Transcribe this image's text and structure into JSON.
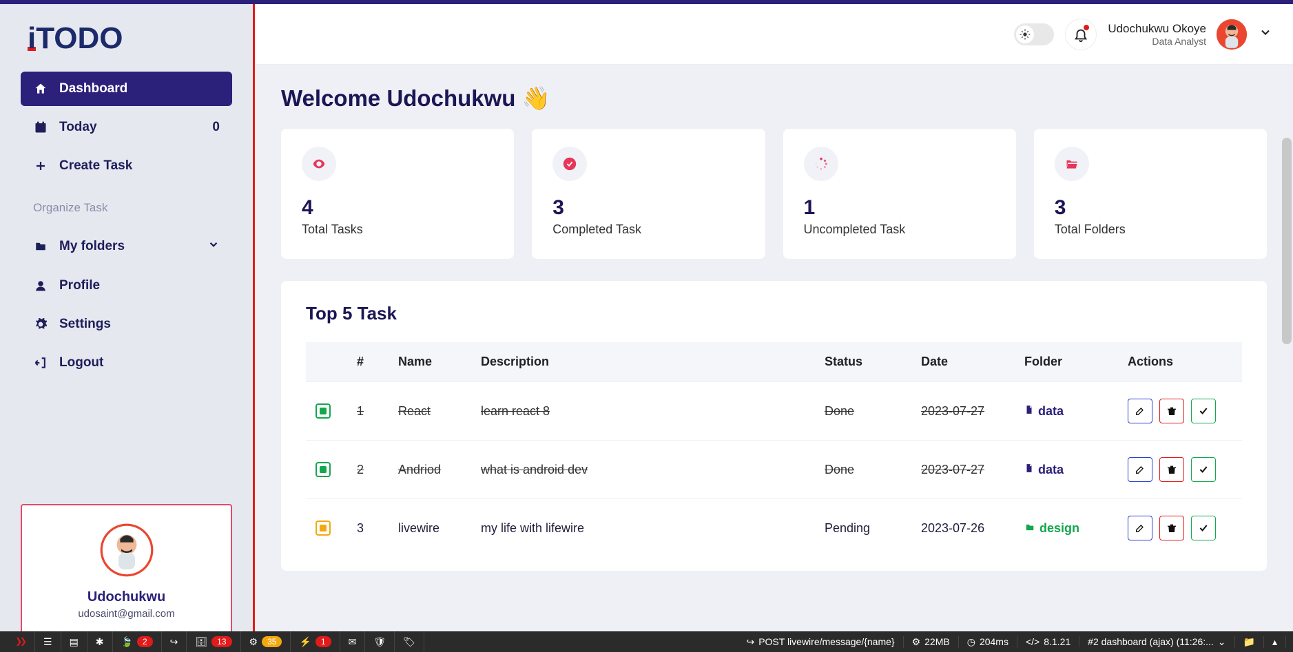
{
  "brand": "iTODO",
  "sidebar": {
    "items": [
      {
        "label": "Dashboard"
      },
      {
        "label": "Today",
        "count": "0"
      },
      {
        "label": "Create Task"
      }
    ],
    "section": "Organize Task",
    "items2": [
      {
        "label": "My folders"
      },
      {
        "label": "Profile"
      },
      {
        "label": "Settings"
      },
      {
        "label": "Logout"
      }
    ]
  },
  "user_card": {
    "name": "Udochukwu",
    "email": "udosaint@gmail.com"
  },
  "header": {
    "name": "Udochukwu Okoye",
    "role": "Data Analyst"
  },
  "welcome": "Welcome Udochukwu 👋",
  "stats": [
    {
      "value": "4",
      "label": "Total Tasks"
    },
    {
      "value": "3",
      "label": "Completed Task"
    },
    {
      "value": "1",
      "label": "Uncompleted Task"
    },
    {
      "value": "3",
      "label": "Total Folders"
    }
  ],
  "table": {
    "title": "Top 5 Task",
    "headers": {
      "hash": "#",
      "name": "Name",
      "desc": "Description",
      "status": "Status",
      "date": "Date",
      "folder": "Folder",
      "actions": "Actions"
    },
    "rows": [
      {
        "idx": "1",
        "name": "React",
        "desc": "learn react 8",
        "status": "Done",
        "date": "2023-07-27",
        "folder": "data",
        "done": true,
        "folder_color": "purple"
      },
      {
        "idx": "2",
        "name": "Andriod",
        "desc": "what is android dev",
        "status": "Done",
        "date": "2023-07-27",
        "folder": "data",
        "done": true,
        "folder_color": "purple"
      },
      {
        "idx": "3",
        "name": "livewire",
        "desc": "my life with lifewire",
        "status": "Pending",
        "date": "2023-07-26",
        "folder": "design",
        "done": false,
        "folder_color": "green"
      }
    ]
  },
  "debugbar": {
    "badges": [
      "2",
      "13",
      "35",
      "1"
    ],
    "route": "POST livewire/message/{name}",
    "mem": "22MB",
    "time": "204ms",
    "php": "8.1.21",
    "current": "#2 dashboard (ajax) (11:26:..."
  }
}
